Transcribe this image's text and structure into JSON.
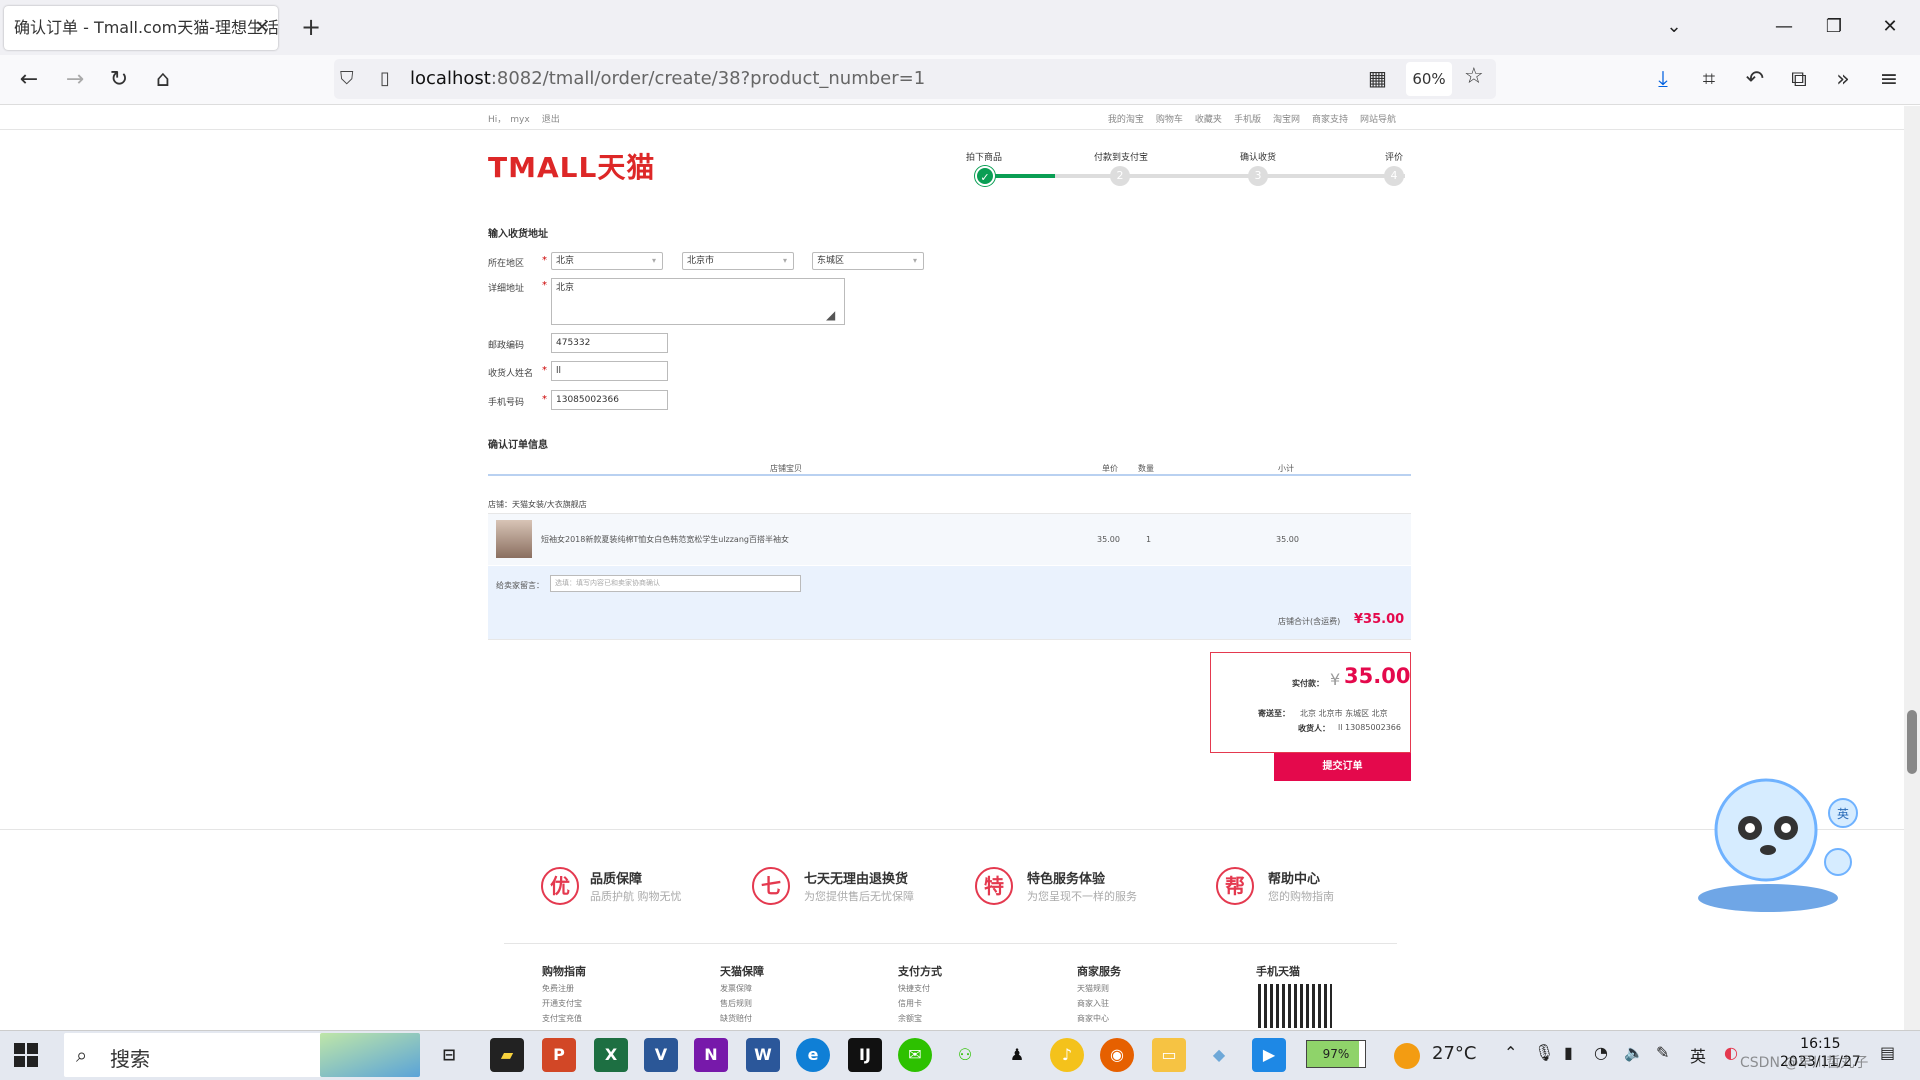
{
  "browser": {
    "tab_title": "确认订单 - Tmall.com天猫-理想生活",
    "tab_close": "✕",
    "new_tab": "+",
    "url_host": "localhost",
    "url_path": ":8082/tmall/order/create/38?product_number=1",
    "zoom": "60%"
  },
  "topnav": {
    "greeting": "Hi，",
    "user": "myx",
    "logout": "退出",
    "links": [
      "我的淘宝",
      "购物车",
      "收藏夹",
      "手机版",
      "淘宝网",
      "商家支持",
      "网站导航"
    ]
  },
  "logo": "TMALL天猫",
  "steps": [
    {
      "label": "拍下商品",
      "num": "✓"
    },
    {
      "label": "付款到支付宝",
      "num": "2"
    },
    {
      "label": "确认收货",
      "num": "3"
    },
    {
      "label": "评价",
      "num": "4"
    }
  ],
  "address": {
    "section_title": "输入收货地址",
    "region_label": "所在地区",
    "province": "北京",
    "city": "北京市",
    "district": "东城区",
    "detail_label": "详细地址",
    "detail_value": "北京",
    "postcode_label": "邮政编码",
    "postcode_value": "475332",
    "receiver_label": "收货人姓名",
    "receiver_value": "ll",
    "phone_label": "手机号码",
    "phone_value": "13085002366",
    "required_mark": "*"
  },
  "order": {
    "section_title": "确认订单信息",
    "headers": [
      "店铺宝贝",
      "单价",
      "数量",
      "小计"
    ],
    "shop": "店铺：天猫女装/大衣旗舰店",
    "product_name": "短袖女2018新款夏装纯棉T恤女白色韩范宽松学生ulzzang百搭半袖女",
    "price": "35.00",
    "quantity": "1",
    "subtotal": "35.00",
    "message_label": "给卖家留言：",
    "message_placeholder": "选填：填写内容已和卖家协商确认",
    "shop_total_label": "店铺合计(含运费)",
    "shop_total": "¥35.00"
  },
  "pay": {
    "actual_label": "实付款：",
    "currency": "¥",
    "amount": "35.00",
    "ship_to_label": "寄送至：",
    "ship_to": "北京 北京市 东城区 北京",
    "receiver_label": "收货人：",
    "receiver": "ll 13085002366",
    "submit": "提交订单"
  },
  "footer": {
    "features": [
      {
        "badge": "优",
        "title": "品质保障",
        "sub": "品质护航 购物无忧"
      },
      {
        "badge": "七",
        "title": "七天无理由退换货",
        "sub": "为您提供售后无忧保障"
      },
      {
        "badge": "特",
        "title": "特色服务体验",
        "sub": "为您呈现不一样的服务"
      },
      {
        "badge": "帮",
        "title": "帮助中心",
        "sub": "您的购物指南"
      }
    ],
    "groups": [
      {
        "head": "购物指南",
        "links": [
          "免费注册",
          "开通支付宝",
          "支付宝充值"
        ]
      },
      {
        "head": "天猫保障",
        "links": [
          "发票保障",
          "售后规则",
          "缺货赔付"
        ]
      },
      {
        "head": "支付方式",
        "links": [
          "快捷支付",
          "信用卡",
          "余额宝"
        ]
      },
      {
        "head": "商家服务",
        "links": [
          "天猫规则",
          "商家入驻",
          "商家中心"
        ]
      },
      {
        "head": "手机天猫",
        "links": []
      }
    ]
  },
  "taskbar": {
    "search_placeholder": "搜索",
    "battery": "97%",
    "weather": "27°C",
    "ime": "英",
    "time": "16:15",
    "date": "2023/11/27",
    "watermark": "CSDN @早川哲丸子"
  },
  "colors": {
    "tmall_red": "#dd2727",
    "submit_red": "#e4094c",
    "step_green": "#0a9e54"
  }
}
